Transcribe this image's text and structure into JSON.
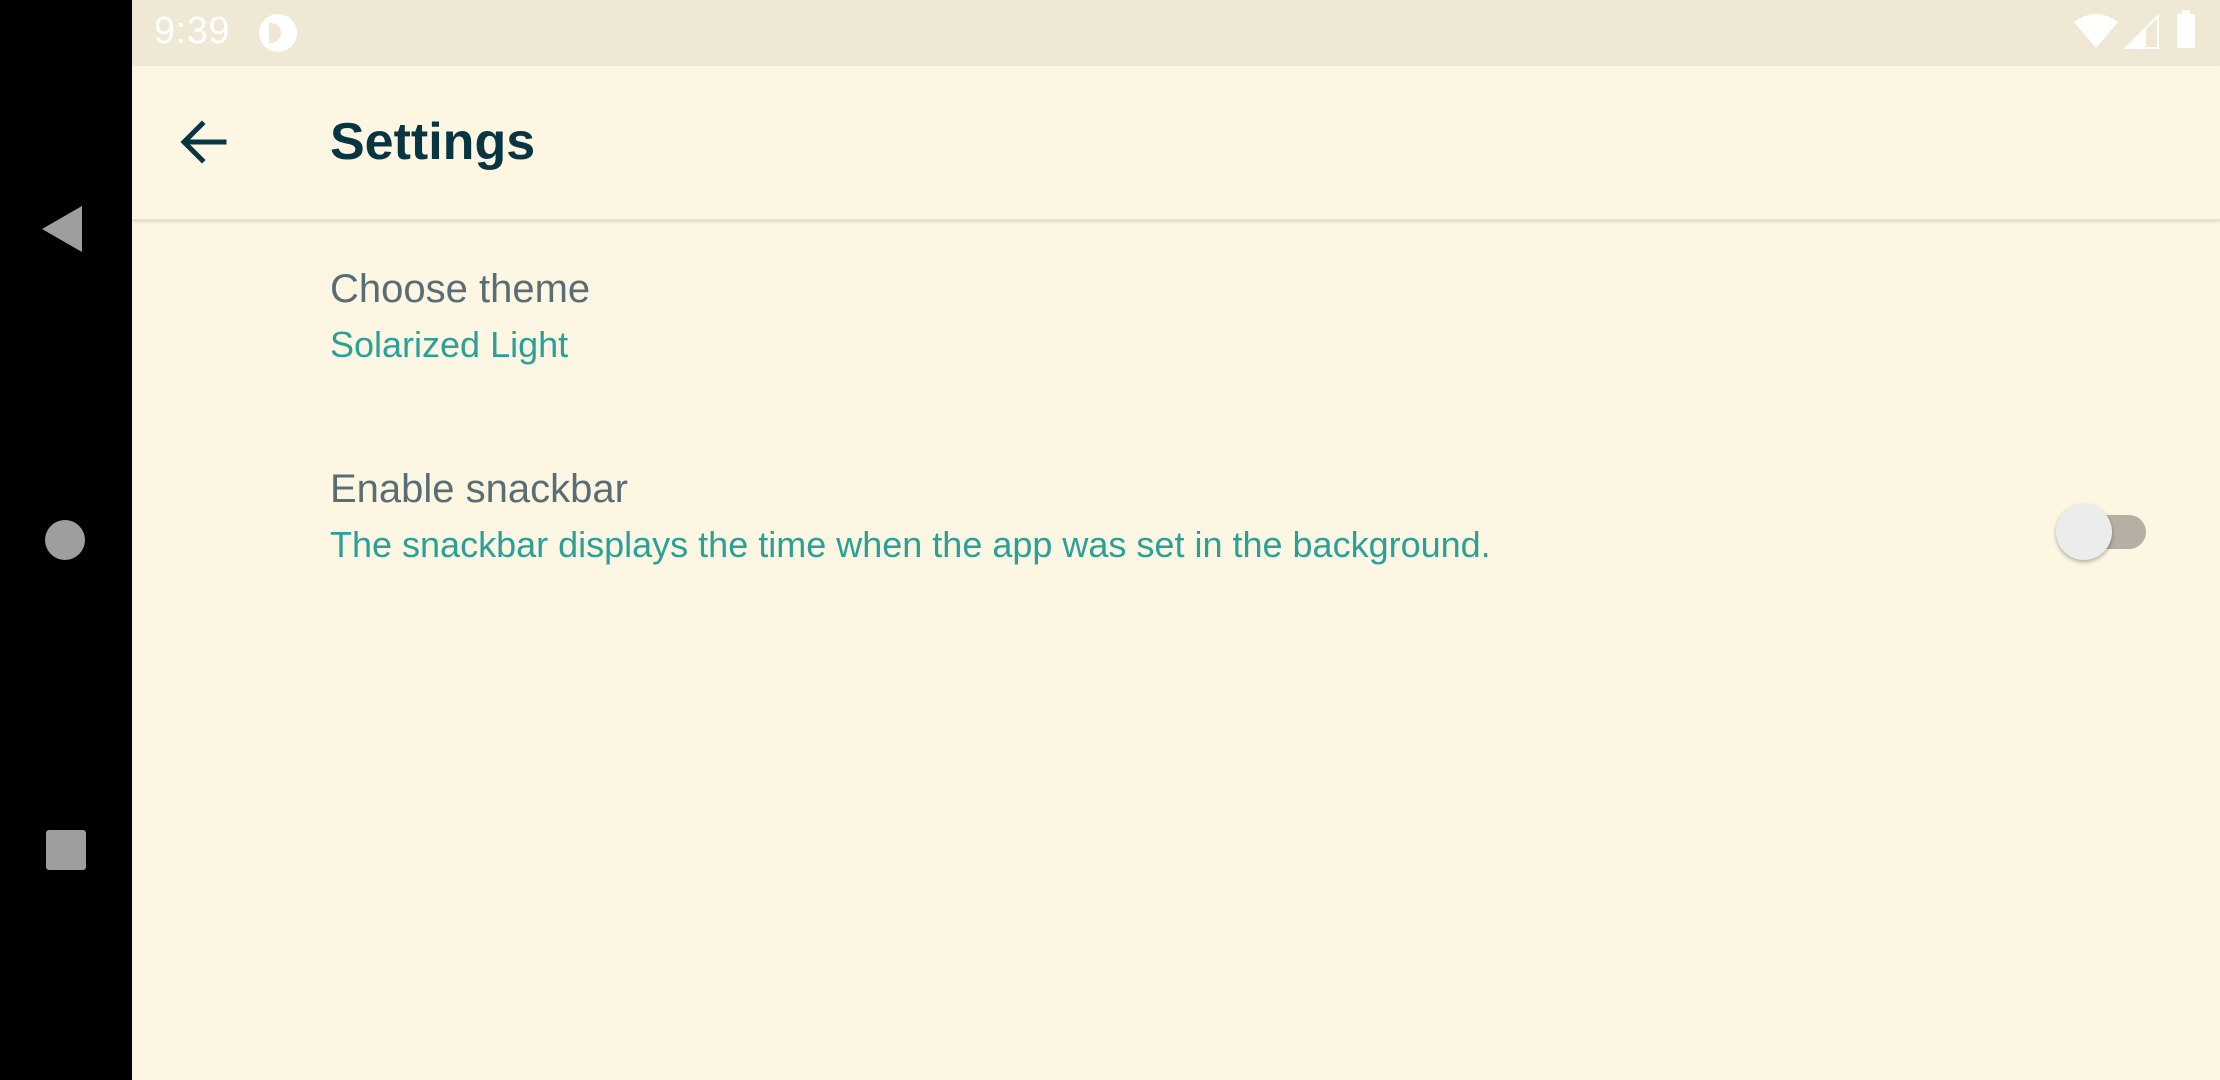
{
  "status_bar": {
    "time": "9:39",
    "icons": [
      "app-notification-icon",
      "wifi-icon",
      "signal-icon",
      "battery-icon"
    ]
  },
  "navigation_bar": {
    "buttons": [
      "back-triangle-icon",
      "home-circle-icon",
      "recents-square-icon"
    ]
  },
  "app_bar": {
    "back_icon": "arrow-left-icon",
    "title": "Settings"
  },
  "settings": {
    "theme": {
      "title": "Choose theme",
      "summary": "Solarized Light"
    },
    "snackbar": {
      "title": "Enable snackbar",
      "summary": "The snackbar displays the time when the app was set in the background.",
      "enabled": false
    }
  },
  "colors": {
    "background": "#fdf6e3",
    "status_bar": "#eee8d5",
    "title_text": "#073642",
    "pref_title": "#586e75",
    "accent": "#2aa198"
  }
}
